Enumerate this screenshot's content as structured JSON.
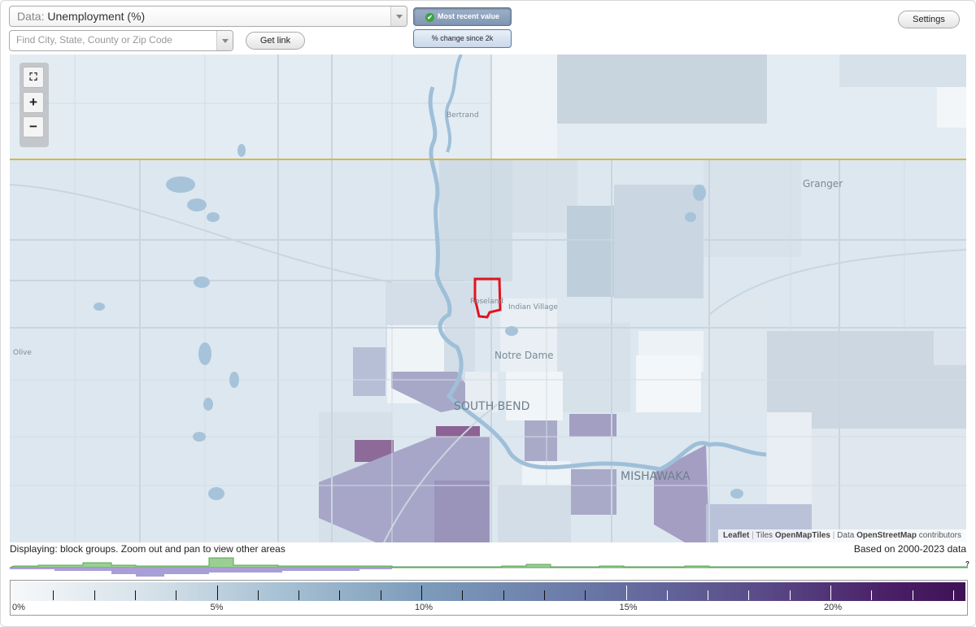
{
  "controls": {
    "data_label": "Data:",
    "data_value": "Unemployment (%)",
    "search_placeholder": "Find City, State, County or Zip Code",
    "get_link": "Get link",
    "most_recent": "Most recent value",
    "pct_change": "% change since 2k",
    "settings": "Settings"
  },
  "map": {
    "places": {
      "bertrand": "Bertrand",
      "granger": "Granger",
      "roseland": "Roseland",
      "indian_village": "Indian Village",
      "olive": "Olive",
      "notre_dame": "Notre Dame",
      "south_bend": "SOUTH BEND",
      "mishawaka": "MISHAWAKA"
    },
    "attribution": {
      "leaflet": "Leaflet",
      "tiles_label": "Tiles",
      "tiles": "OpenMapTiles",
      "data_label": "Data",
      "osm": "OpenStreetMap",
      "contributors": "contributors"
    },
    "zoom": {
      "fullscreen": "⛶",
      "zoom_in": "+",
      "zoom_out": "−"
    },
    "colors": {
      "state_line": "#d4b84a",
      "highlight": "#e0141e",
      "water": "#9fbfd8"
    }
  },
  "footer": {
    "displaying": "Displaying: block groups. Zoom out and pan to view other areas",
    "based_on": "Based on 2000-2023 data",
    "help": "?"
  },
  "legend": {
    "labels": [
      "0%",
      "5%",
      "10%",
      "15%",
      "20%"
    ],
    "min": 0,
    "max": 23.3
  }
}
